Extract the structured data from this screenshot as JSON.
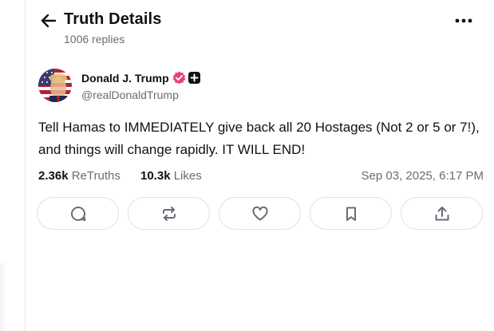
{
  "header": {
    "title": "Truth Details",
    "reply_count": "1006 replies"
  },
  "post": {
    "author_name": "Donald J. Trump",
    "handle": "@realDonaldTrump",
    "text": "Tell Hamas to IMMEDIATELY give back all 20 Hostages (Not 2 or 5 or 7!), and things will change rapidly. IT WILL END!",
    "retruths_count": "2.36k",
    "retruths_label": "ReTruths",
    "likes_count": "10.3k",
    "likes_label": "Likes",
    "timestamp": "Sep 03, 2025, 6:17 PM"
  },
  "actions": [
    "reply-icon",
    "retruth-icon",
    "heart-icon",
    "bookmark-icon",
    "share-icon"
  ],
  "colors": {
    "verified_badge": "#e8417f",
    "muted_text": "#6b6b76",
    "border": "#e0e0e6",
    "icon": "#6b6b76"
  }
}
